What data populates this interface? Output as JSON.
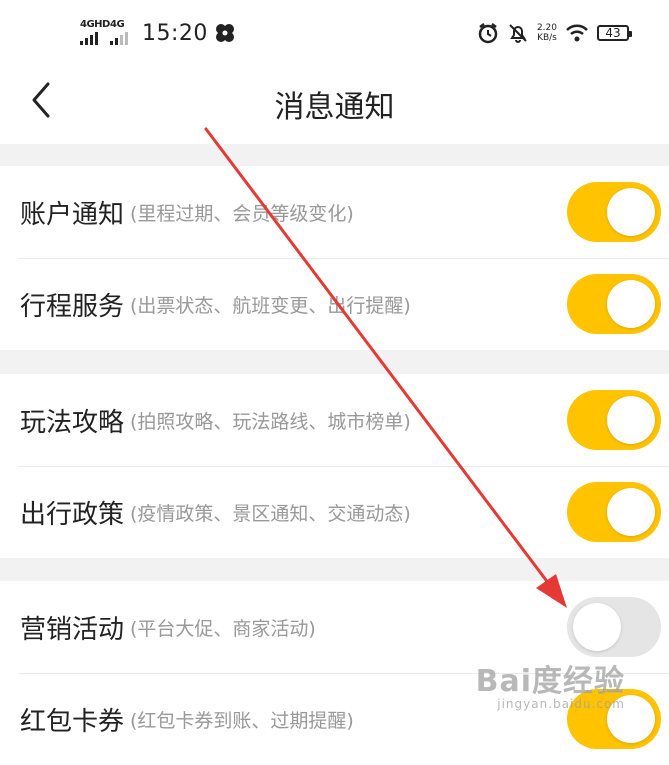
{
  "status_bar": {
    "net1_label": "4GHD",
    "net2_label": "4G",
    "time": "15:20",
    "speed_value": "2.20",
    "speed_unit": "KB/s",
    "battery": "43"
  },
  "header": {
    "title": "消息通知"
  },
  "groups": [
    {
      "rows": [
        {
          "title": "账户通知",
          "subtitle": "(里程过期、会员等级变化)",
          "enabled": true
        },
        {
          "title": "行程服务",
          "subtitle": "(出票状态、航班变更、出行提醒)",
          "enabled": true
        }
      ]
    },
    {
      "rows": [
        {
          "title": "玩法攻略",
          "subtitle": "(拍照攻略、玩法路线、城市榜单)",
          "enabled": true
        },
        {
          "title": "出行政策",
          "subtitle": "(疫情政策、景区通知、交通动态)",
          "enabled": true
        }
      ]
    },
    {
      "rows": [
        {
          "title": "营销活动",
          "subtitle": "(平台大促、商家活动)",
          "enabled": false
        },
        {
          "title": "红包卡券",
          "subtitle": "(红包卡券到账、过期提醒)",
          "enabled": true
        }
      ]
    }
  ],
  "colors": {
    "toggle_on": "#ffc300",
    "toggle_off": "#e5e5e5",
    "arrow": "#e53935"
  },
  "watermark": {
    "main": "Bai度经验",
    "sub": "jingyan.baidu.com"
  }
}
